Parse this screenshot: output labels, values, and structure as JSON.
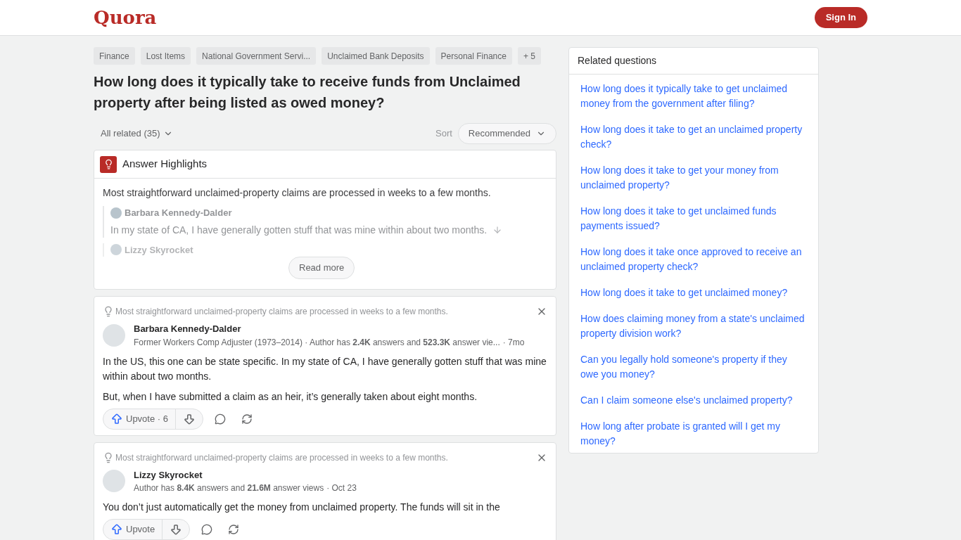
{
  "header": {
    "logo": "Quora",
    "sign_in": "Sign In"
  },
  "topics": [
    "Finance",
    "Lost Items",
    "National Government Servi...",
    "Unclaimed Bank Deposits",
    "Personal Finance",
    "+ 5"
  ],
  "question": "How long does it typically take to receive funds from Unclaimed property after being listed as owed money?",
  "filter": {
    "label": "All related (35)",
    "sort_label": "Sort",
    "sort_value": "Recommended"
  },
  "highlights": {
    "title": "Answer Highlights",
    "summary": "Most straightforward unclaimed-property claims are processed in weeks to a few months.",
    "quotes": [
      {
        "author": "Barbara Kennedy-Dalder",
        "text": "In my state of CA, I have generally gotten stuff that was mine within about two months.",
        "faded": false
      },
      {
        "author": "Lizzy Skyrocket",
        "faded": true
      }
    ],
    "read_more": "Read more"
  },
  "answers": [
    {
      "highlight": "Most straightforward unclaimed-property claims are processed in weeks to a few months.",
      "author": "Barbara Kennedy-Dalder",
      "meta": "Former Workers Comp Adjuster (1973–2014) · Author has **2.4K** answers and **523.3K** answer vie...",
      "time": "· 7mo",
      "paragraphs": [
        "In the US, this one can be state specific. In my state of CA, I have generally gotten stuff that was mine within about two months.",
        "But, when I have submitted a claim as an heir, it’s generally taken about eight months."
      ],
      "upvote": "Upvote · 6"
    },
    {
      "highlight": "Most straightforward unclaimed-property claims are processed in weeks to a few months.",
      "author": "Lizzy Skyrocket",
      "meta": "Author has **8.4K** answers and **21.6M** answer views",
      "time": "· Oct 23",
      "paragraphs": [
        "You don’t just automatically get the money from unclaimed property. The funds will sit in the"
      ],
      "upvote": "Upvote"
    }
  ],
  "related": {
    "title": "Related questions",
    "items": [
      "How long does it typically take to get unclaimed money from the government after filing?",
      "How long does it take to get an unclaimed property check?",
      "How long does it take to get your money from unclaimed property?",
      "How long does it take to get unclaimed funds payments issued?",
      "How long does it take once approved to receive an unclaimed property check?",
      "How long does it take to get unclaimed money?",
      "How does claiming money from a state's unclaimed property division work?",
      "Can you legally hold someone's property if they owe you money?",
      "Can I claim someone else's unclaimed property?",
      "How long after probate is granted will I get my money?"
    ]
  }
}
